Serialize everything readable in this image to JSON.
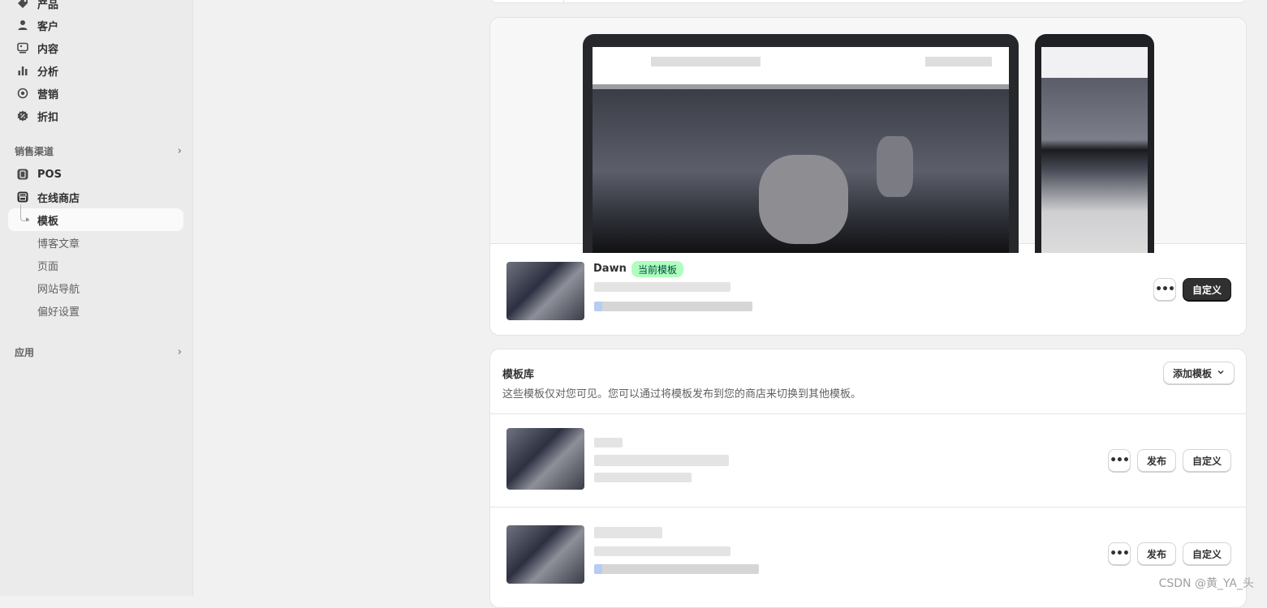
{
  "sidebar": {
    "items": [
      {
        "label": "产品",
        "icon": "tag-icon"
      },
      {
        "label": "客户",
        "icon": "person-icon"
      },
      {
        "label": "内容",
        "icon": "image-icon"
      },
      {
        "label": "分析",
        "icon": "bar-chart-icon"
      },
      {
        "label": "营销",
        "icon": "target-icon"
      },
      {
        "label": "折扣",
        "icon": "discount-icon"
      }
    ],
    "sales_channels_label": "销售渠道",
    "channels": [
      {
        "label": "POS",
        "icon": "pos-icon"
      },
      {
        "label": "在线商店",
        "icon": "store-icon"
      }
    ],
    "online_store_sub": [
      "模板",
      "博客文章",
      "页面",
      "网站导航",
      "偏好设置"
    ],
    "apps_label": "应用"
  },
  "current_theme": {
    "name": "Dawn",
    "badge": "当前模板",
    "more_label": "•••",
    "customize_label": "自定义"
  },
  "library": {
    "title": "模板库",
    "description": "这些模板仅对您可见。您可以通过将模板发布到您的商店来切换到其他模板。",
    "add_theme_label": "添加模板",
    "rows": [
      {
        "more_label": "•••",
        "publish_label": "发布",
        "customize_label": "自定义"
      },
      {
        "more_label": "•••",
        "publish_label": "发布",
        "customize_label": "自定义"
      }
    ]
  },
  "watermark": "CSDN @黄_YA_头",
  "colors": {
    "badge_bg": "#affebf",
    "primary_button": "#303030",
    "sidebar_bg": "#ebebeb"
  }
}
